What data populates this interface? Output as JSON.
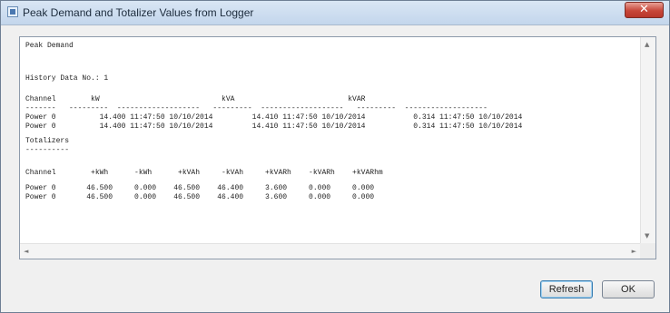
{
  "window": {
    "title": "Peak Demand and Totalizer Values from Logger",
    "close_glyph": "✕"
  },
  "report": {
    "heading": "Peak Demand",
    "history_line": "History Data No.: 1",
    "peak_header": "Channel        kW                            kVA                          kVAR",
    "peak_rule": "-------   ---------  -------------------   ---------  -------------------   ---------  -------------------",
    "peak_rows": [
      "Power 0          14.400 11:47:50 10/10/2014         14.410 11:47:50 10/10/2014           0.314 11:47:50 10/10/2014",
      "Power 0          14.400 11:47:50 10/10/2014         14.410 11:47:50 10/10/2014           0.314 11:47:50 10/10/2014"
    ],
    "totalizer_heading": "Totalizers",
    "totalizer_rule": "----------",
    "totalizer_header": "Channel        +kWh      -kWh      +kVAh     -kVAh     +kVARh    -kVARh    +kVARhm",
    "totalizer_rows": [
      "Power 0       46.500     0.000    46.500    46.400     3.600     0.000     0.000",
      "Power 0       46.500     0.000    46.500    46.400     3.600     0.000     0.000"
    ]
  },
  "scrollbars": {
    "up": "▲",
    "down": "▼",
    "left": "◄",
    "right": "►"
  },
  "buttons": {
    "refresh": "Refresh",
    "ok": "OK"
  }
}
